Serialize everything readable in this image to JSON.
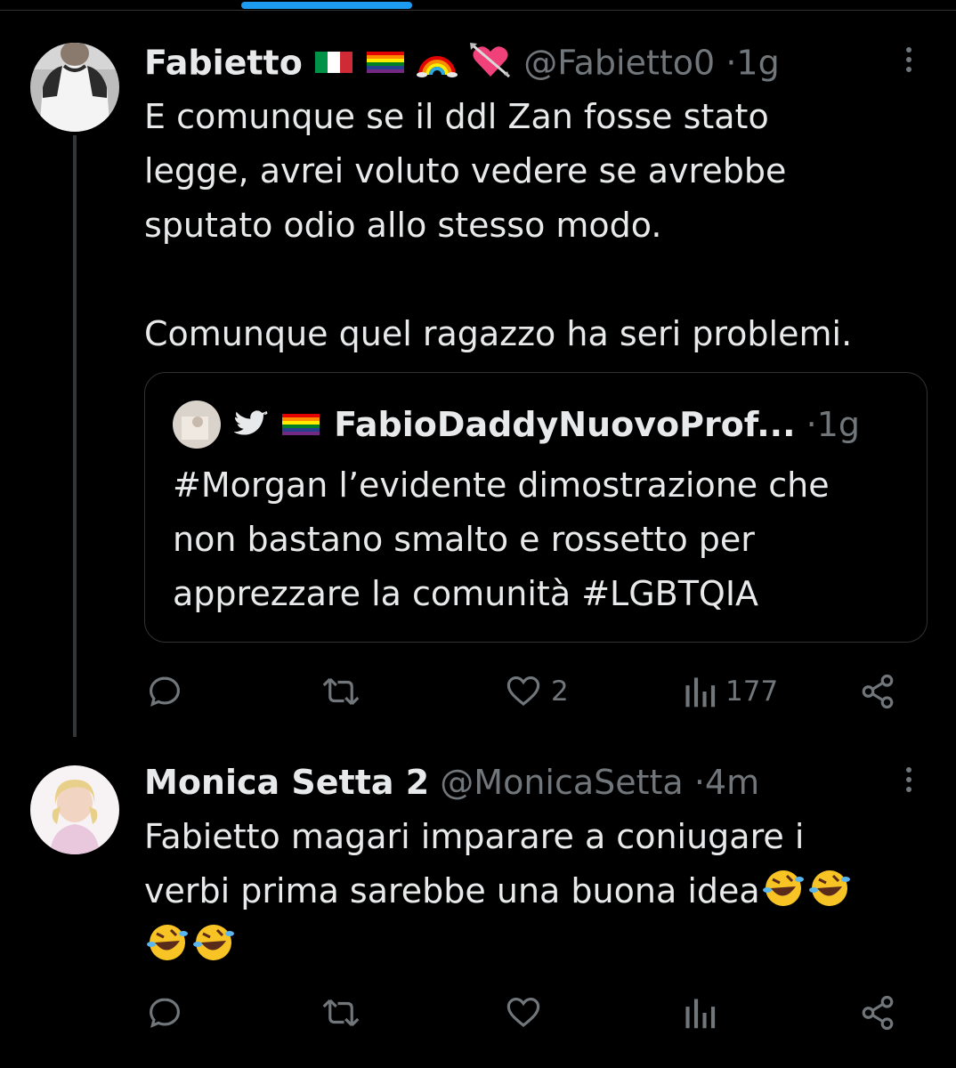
{
  "tweet1": {
    "display_name": "Fabietto",
    "handle": "@Fabietto0",
    "separator": "·",
    "time": "1g",
    "lines": [
      "E comunque se il ddl Zan fosse stato",
      "legge, avrei voluto vedere se avrebbe",
      "sputato odio allo stesso modo.",
      "",
      "Comunque quel ragazzo ha seri problemi."
    ],
    "quoted": {
      "display_name": "FabioDaddyNuovoProf...",
      "separator": "·",
      "time": "1g",
      "lines": [
        "#Morgan l’evidente dimostrazione che",
        "non bastano smalto e rossetto per",
        "apprezzare la comunità #LGBTQIA"
      ]
    },
    "actions": {
      "reply_icon": "reply-icon",
      "retweet_icon": "retweet-icon",
      "like_icon": "heart-icon",
      "likes": "2",
      "views_icon": "views-chart-icon",
      "views": "177",
      "share_icon": "share-icon"
    }
  },
  "tweet2": {
    "display_name": "Monica Setta 2",
    "handle": "@MonicaSetta",
    "separator": "·",
    "time": "4m",
    "lines": [
      "Fabietto magari imparare a coniugare i",
      "verbi prima sarebbe una buona idea",
      ""
    ],
    "actions": {
      "reply_icon": "reply-icon",
      "retweet_icon": "retweet-icon",
      "like_icon": "heart-icon",
      "views_icon": "views-chart-icon",
      "share_icon": "share-icon"
    }
  },
  "colors": {
    "background": "#000000",
    "text": "#e7e9ea",
    "muted": "#71767b",
    "border": "#2f3336",
    "accent": "#1d9bf0"
  }
}
